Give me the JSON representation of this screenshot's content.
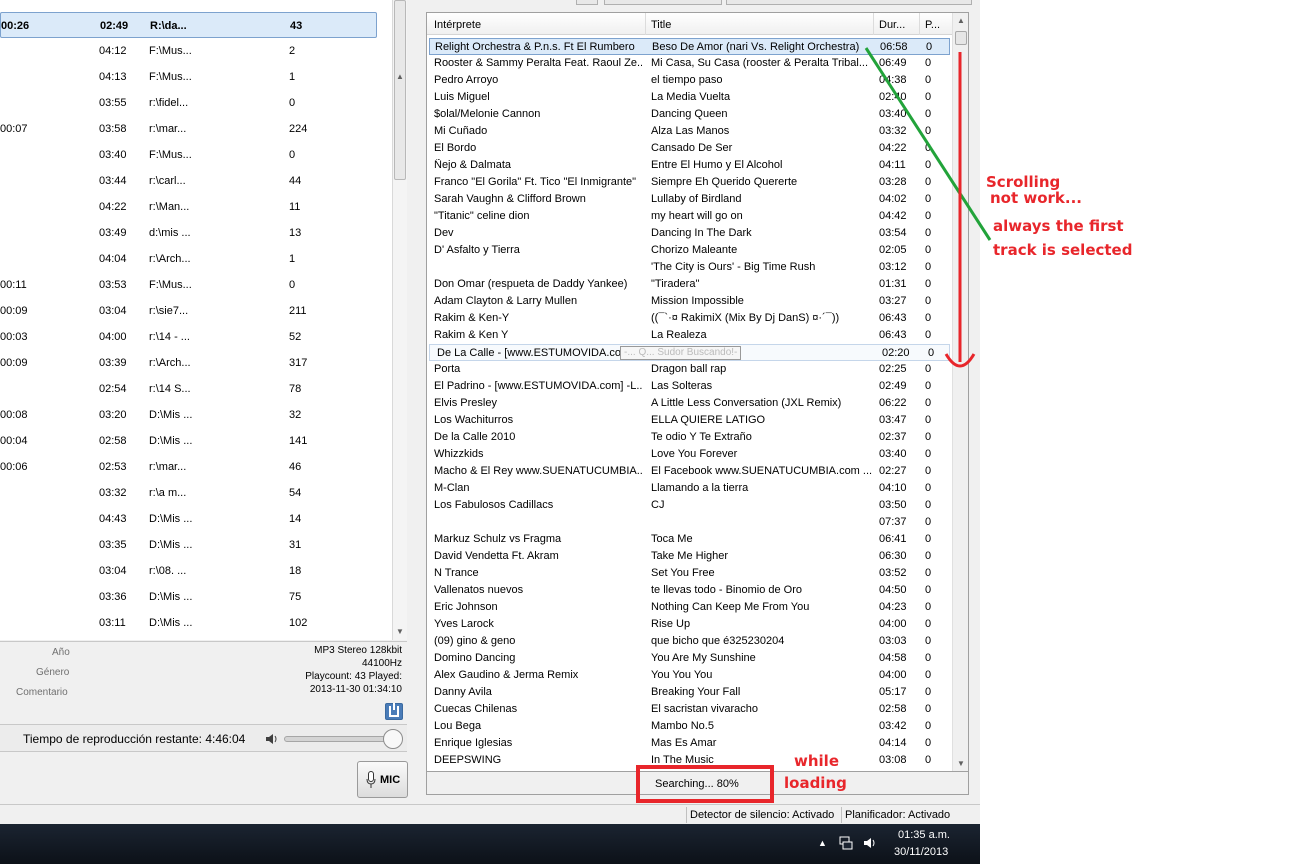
{
  "left_list": {
    "rows": [
      {
        "c1": "00:26",
        "c2": "02:49",
        "c3": "R:\\da...",
        "c4": "43",
        "selected": true
      },
      {
        "c1": "",
        "c2": "04:12",
        "c3": "F:\\Mus...",
        "c4": "2"
      },
      {
        "c1": "",
        "c2": "04:13",
        "c3": "F:\\Mus...",
        "c4": "1"
      },
      {
        "c1": "",
        "c2": "03:55",
        "c3": "r:\\fidel...",
        "c4": "0"
      },
      {
        "c1": "00:07",
        "c2": "03:58",
        "c3": "r:\\mar...",
        "c4": "224"
      },
      {
        "c1": "",
        "c2": "03:40",
        "c3": "F:\\Mus...",
        "c4": "0"
      },
      {
        "c1": "",
        "c2": "03:44",
        "c3": "r:\\carl...",
        "c4": "44"
      },
      {
        "c1": "",
        "c2": "04:22",
        "c3": "r:\\Man...",
        "c4": "11"
      },
      {
        "c1": "",
        "c2": "03:49",
        "c3": "d:\\mis ...",
        "c4": "13"
      },
      {
        "c1": "",
        "c2": "04:04",
        "c3": "r:\\Arch...",
        "c4": "1"
      },
      {
        "c1": "00:11",
        "c2": "03:53",
        "c3": "F:\\Mus...",
        "c4": "0"
      },
      {
        "c1": "00:09",
        "c2": "03:04",
        "c3": "r:\\sie7...",
        "c4": "211"
      },
      {
        "c1": "00:03",
        "c2": "04:00",
        "c3": "r:\\14 - ...",
        "c4": "52"
      },
      {
        "c1": "00:09",
        "c2": "03:39",
        "c3": "r:\\Arch...",
        "c4": "317"
      },
      {
        "c1": "",
        "c2": "02:54",
        "c3": "r:\\14 S...",
        "c4": "78"
      },
      {
        "c1": "00:08",
        "c2": "03:20",
        "c3": "D:\\Mis ...",
        "c4": "32"
      },
      {
        "c1": "00:04",
        "c2": "02:58",
        "c3": "D:\\Mis ...",
        "c4": "141"
      },
      {
        "c1": "00:06",
        "c2": "02:53",
        "c3": "r:\\mar...",
        "c4": "46"
      },
      {
        "c1": "",
        "c2": "03:32",
        "c3": "r:\\a m...",
        "c4": "54"
      },
      {
        "c1": "",
        "c2": "04:43",
        "c3": "D:\\Mis ...",
        "c4": "14"
      },
      {
        "c1": "",
        "c2": "03:35",
        "c3": "D:\\Mis ...",
        "c4": "31"
      },
      {
        "c1": "",
        "c2": "03:04",
        "c3": "r:\\08. ...",
        "c4": "18"
      },
      {
        "c1": "",
        "c2": "03:36",
        "c3": "D:\\Mis ...",
        "c4": "75"
      },
      {
        "c1": "",
        "c2": "03:11",
        "c3": "D:\\Mis ...",
        "c4": "102"
      }
    ]
  },
  "info": {
    "label_year": "Año",
    "label_genre": "Género",
    "label_comment": "Comentario",
    "format": "MP3 Stereo 128kbit",
    "rate": "44100Hz",
    "playcount": "Playcount: 43  Played:",
    "played": "2013-11-30 01:34:10"
  },
  "time_bar": {
    "text": "Tiempo de reproducción restante: 4:46:04",
    "volume": 1.0
  },
  "mic_button": {
    "label": "MIC"
  },
  "grid": {
    "columns": [
      "Intérprete",
      "Title",
      "Dur...",
      "P..."
    ],
    "hover_tooltip": "-... Q... Sudor Buscando!-",
    "rows": [
      {
        "artist": "Relight Orchestra & P.n.s. Ft El Rumbero",
        "title": "Beso De Amor (nari Vs. Relight Orchestra)",
        "dur": "06:58",
        "p": "0",
        "selected": true
      },
      {
        "artist": "Rooster & Sammy Peralta Feat. Raoul Ze...",
        "title": "Mi Casa, Su Casa (rooster & Peralta Tribal...",
        "dur": "06:49",
        "p": "0"
      },
      {
        "artist": "Pedro Arroyo",
        "title": "el tiempo paso",
        "dur": "04:38",
        "p": "0"
      },
      {
        "artist": "Luis Miguel",
        "title": "La Media Vuelta",
        "dur": "02:40",
        "p": "0"
      },
      {
        "artist": "$olal/Melonie Cannon",
        "title": "Dancing Queen",
        "dur": "03:40",
        "p": "0"
      },
      {
        "artist": "Mi Cuñado",
        "title": "Alza Las Manos",
        "dur": "03:32",
        "p": "0"
      },
      {
        "artist": "El Bordo",
        "title": "Cansado De Ser",
        "dur": "04:22",
        "p": "0"
      },
      {
        "artist": "Ñejo & Dalmata",
        "title": "Entre El Humo y El Alcohol",
        "dur": "04:11",
        "p": "0"
      },
      {
        "artist": "Franco \"El Gorila\" Ft. Tico \"El Inmigrante\"",
        "title": "Siempre Eh Querido Quererte",
        "dur": "03:28",
        "p": "0"
      },
      {
        "artist": "Sarah Vaughn & Clifford Brown",
        "title": "Lullaby of Birdland",
        "dur": "04:02",
        "p": "0"
      },
      {
        "artist": "\"Titanic\" celine dion",
        "title": "my heart will go on",
        "dur": "04:42",
        "p": "0"
      },
      {
        "artist": "Dev",
        "title": "Dancing In The Dark",
        "dur": "03:54",
        "p": "0"
      },
      {
        "artist": "D' Asfalto y Tierra",
        "title": "Chorizo Maleante",
        "dur": "02:05",
        "p": "0"
      },
      {
        "artist": "",
        "title": "'The City is Ours' - Big Time Rush",
        "dur": "03:12",
        "p": "0"
      },
      {
        "artist": "Don Omar (respueta de Daddy Yankee)",
        "title": "\"Tiradera\"",
        "dur": "01:31",
        "p": "0"
      },
      {
        "artist": "Adam Clayton & Larry Mullen",
        "title": "Mission Impossible",
        "dur": "03:27",
        "p": "0"
      },
      {
        "artist": "Rakim & Ken-Y",
        "title": "((¯`·¤ RakimiX (Mix By Dj DanS) ¤·´¯))",
        "dur": "06:43",
        "p": "0"
      },
      {
        "artist": "Rakim & Ken Y",
        "title": "La Realeza",
        "dur": "06:43",
        "p": "0"
      },
      {
        "artist": "De La Calle - [www.ESTUMOVIDA.com] -...",
        "title": "Calor Sudor",
        "dur": "02:20",
        "p": "0",
        "hover": true
      },
      {
        "artist": "Porta",
        "title": "Dragon ball rap",
        "dur": "02:25",
        "p": "0"
      },
      {
        "artist": "El Padrino - [www.ESTUMOVIDA.com] -L...",
        "title": "Las Solteras",
        "dur": "02:49",
        "p": "0"
      },
      {
        "artist": "Elvis Presley",
        "title": "A Little Less Conversation (JXL Remix)",
        "dur": "06:22",
        "p": "0"
      },
      {
        "artist": "Los Wachiturros",
        "title": "ELLA QUIERE LATIGO",
        "dur": "03:47",
        "p": "0"
      },
      {
        "artist": "De la Calle 2010",
        "title": "Te odio Y Te Extraño",
        "dur": "02:37",
        "p": "0"
      },
      {
        "artist": "Whizzkids",
        "title": "Love You Forever",
        "dur": "03:40",
        "p": "0"
      },
      {
        "artist": "Macho & El Rey www.SUENATUCUMBIA....",
        "title": "El Facebook www.SUENATUCUMBIA.com ...",
        "dur": "02:27",
        "p": "0"
      },
      {
        "artist": "M-Clan",
        "title": "Llamando a la tierra",
        "dur": "04:10",
        "p": "0"
      },
      {
        "artist": "Los  Fabulosos Cadillacs",
        "title": "CJ",
        "dur": "03:50",
        "p": "0"
      },
      {
        "artist": "",
        "title": "",
        "dur": "07:37",
        "p": "0"
      },
      {
        "artist": "Markuz Schulz vs Fragma",
        "title": "Toca Me",
        "dur": "06:41",
        "p": "0"
      },
      {
        "artist": "David Vendetta Ft. Akram",
        "title": "Take Me Higher",
        "dur": "06:30",
        "p": "0"
      },
      {
        "artist": "N Trance",
        "title": "Set You Free",
        "dur": "03:52",
        "p": "0"
      },
      {
        "artist": "Vallenatos nuevos",
        "title": "te llevas todo - Binomio de Oro",
        "dur": "04:50",
        "p": "0"
      },
      {
        "artist": "Eric Johnson",
        "title": "Nothing Can Keep Me From You",
        "dur": "04:23",
        "p": "0"
      },
      {
        "artist": "Yves Larock",
        "title": "Rise Up",
        "dur": "04:00",
        "p": "0"
      },
      {
        "artist": "(09) gino & geno",
        "title": "que bicho que é325230204",
        "dur": "03:03",
        "p": "0"
      },
      {
        "artist": "Domino Dancing",
        "title": "You Are My Sunshine",
        "dur": "04:58",
        "p": "0"
      },
      {
        "artist": "Alex Gaudino & Jerma Remix",
        "title": "You You You",
        "dur": "04:00",
        "p": "0"
      },
      {
        "artist": "Danny Avila",
        "title": "Breaking Your Fall",
        "dur": "05:17",
        "p": "0"
      },
      {
        "artist": "Cuecas Chilenas",
        "title": "El sacristan vivaracho",
        "dur": "02:58",
        "p": "0"
      },
      {
        "artist": "Lou Bega",
        "title": "Mambo No.5",
        "dur": "03:42",
        "p": "0"
      },
      {
        "artist": "Enrique Iglesias",
        "title": "Mas Es Amar",
        "dur": "04:14",
        "p": "0"
      },
      {
        "artist": "DEEPSWING",
        "title": "In The Music",
        "dur": "03:08",
        "p": "0"
      }
    ]
  },
  "search_status": "Searching... 80%",
  "status_bar": {
    "silence": "Detector de silencio: Activado",
    "scheduler": "Planificador: Activado"
  },
  "taskbar": {
    "time": "01:35 a.m.",
    "date": "30/11/2013"
  },
  "annotations": {
    "scroll_1": "Scrolling",
    "scroll_2": "not work...",
    "first_1": "always the first",
    "first_2": "track is selected",
    "while_1": "while",
    "while_2": "loading"
  },
  "colors": {
    "annotation_red": "#e8262b",
    "annotation_green": "#22a33a",
    "selection": "#dbeaf9"
  }
}
